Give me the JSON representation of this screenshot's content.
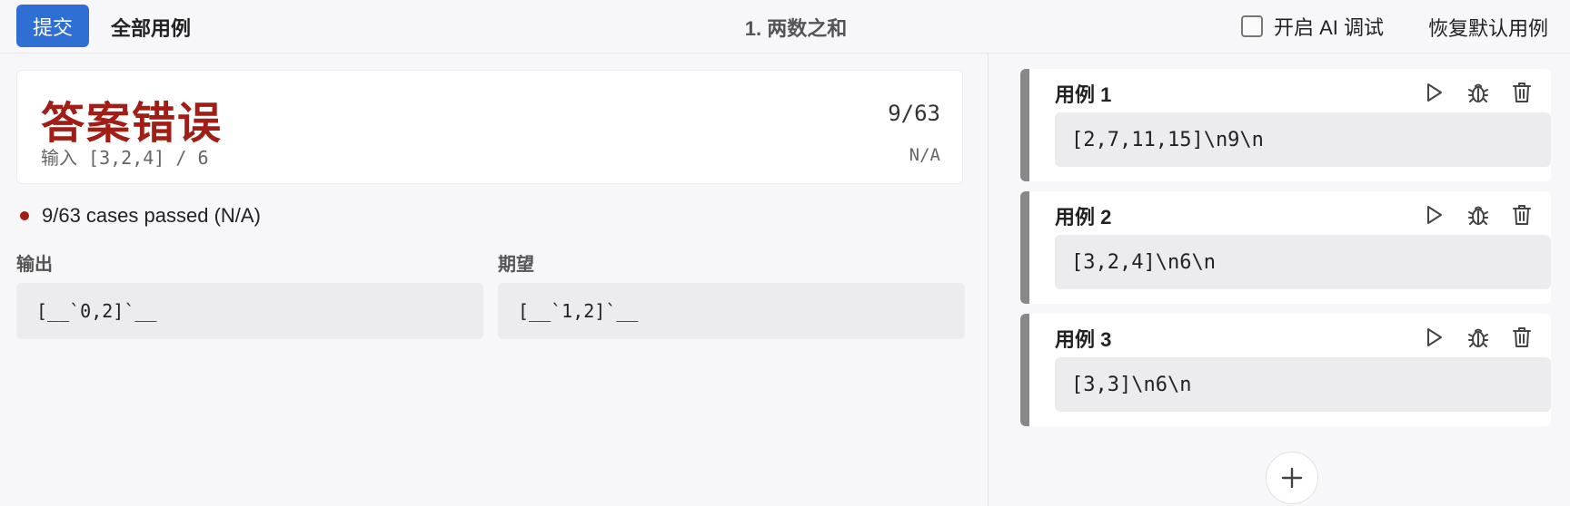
{
  "toolbar": {
    "submit_label": "提交",
    "all_cases_label": "全部用例",
    "title": "1. 两数之和",
    "ai_debug_label": "开启 AI 调试",
    "ai_debug_checked": false,
    "restore_label": "恢复默认用例"
  },
  "result": {
    "verdict": "答案错误",
    "input": "输入 [3,2,4] / 6",
    "score": "9/63",
    "time": "N/A",
    "summary": "9/63 cases passed (N/A)",
    "status_color": "#a11d15"
  },
  "output": {
    "label": "输出",
    "value": "[__`0,2]`__"
  },
  "expected": {
    "label": "期望",
    "value": "[__`1,2]`__"
  },
  "cases": [
    {
      "title": "用例 1",
      "code": "[2,7,11,15]\\n9\\n"
    },
    {
      "title": "用例 2",
      "code": "[3,2,4]\\n6\\n"
    },
    {
      "title": "用例 3",
      "code": "[3,3]\\n6\\n"
    }
  ],
  "icons": {
    "run": "play-icon",
    "debug": "bug-icon",
    "delete": "trash-icon",
    "add": "plus-icon"
  },
  "colors": {
    "accent": "#2f6fd4",
    "error": "#a11d15"
  }
}
